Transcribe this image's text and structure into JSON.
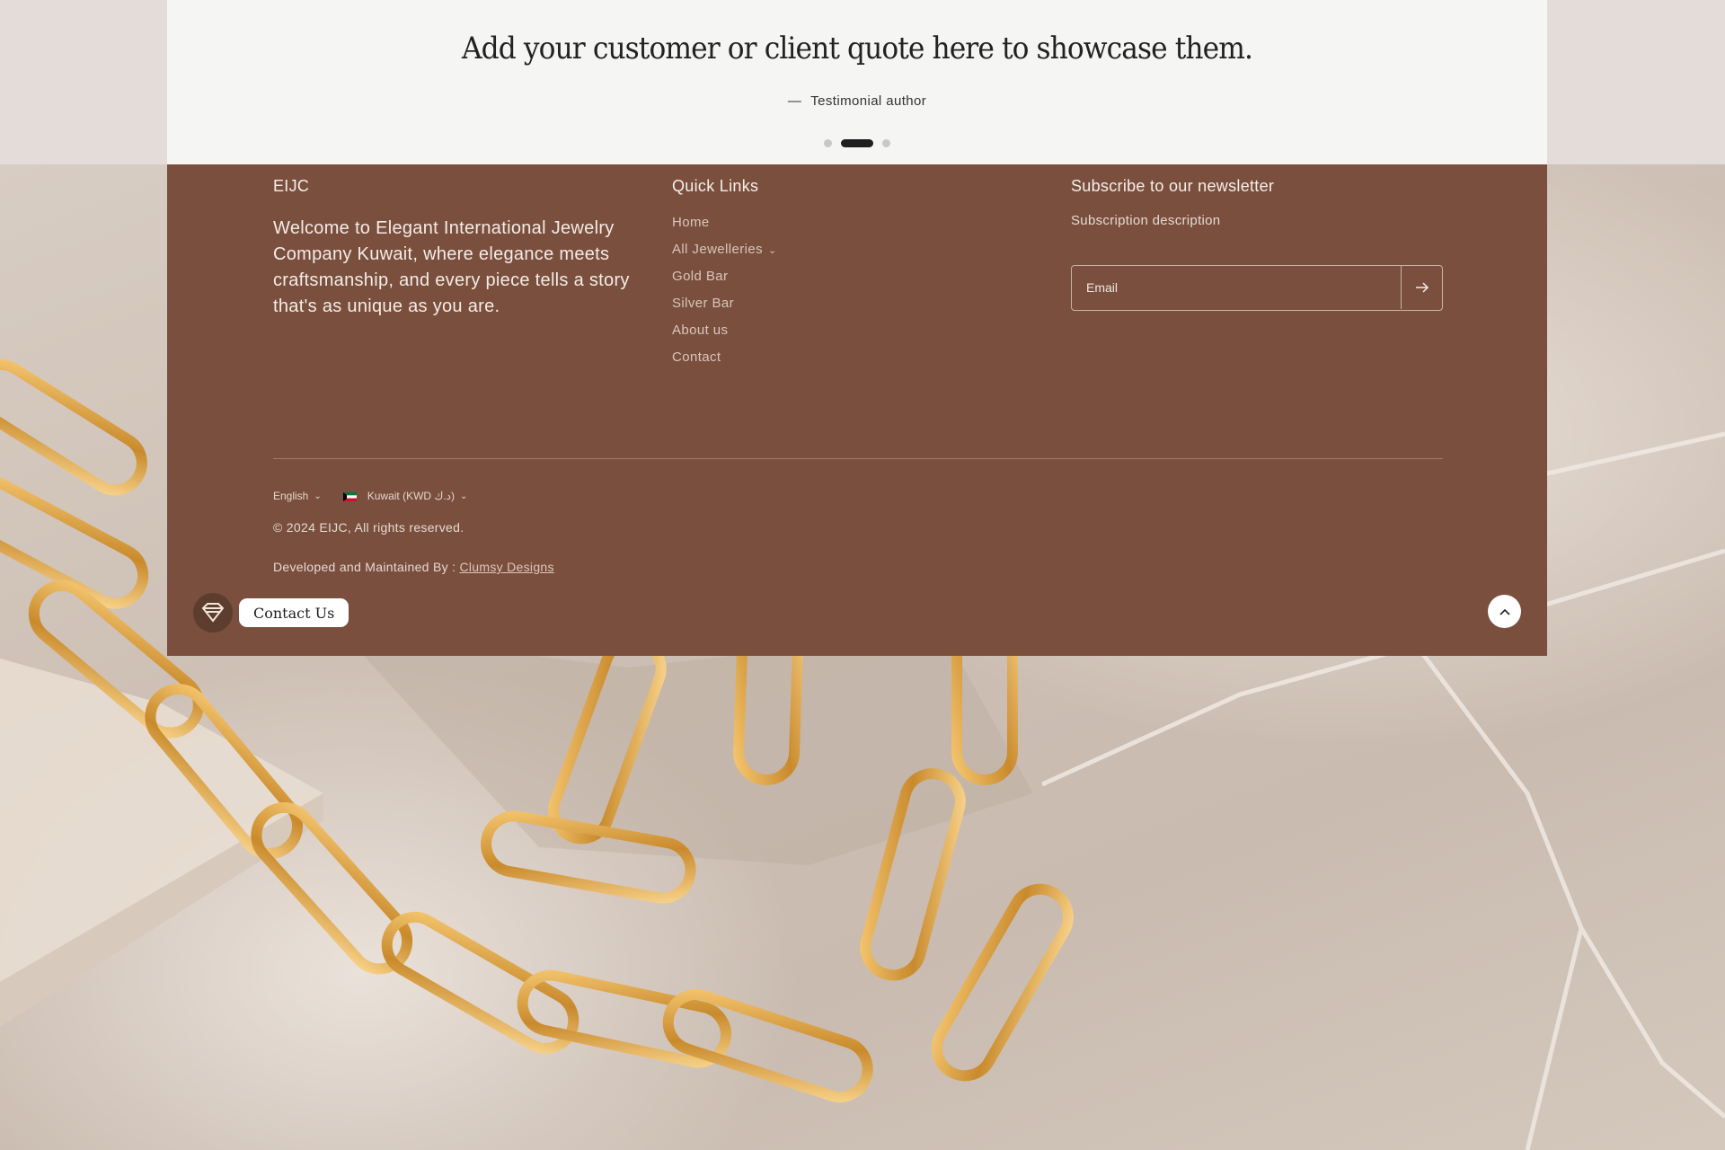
{
  "testimonial": {
    "quote": "Add your customer or client quote here to showcase them.",
    "author_dash": "—",
    "author": "Testimonial author",
    "slides_count": 3,
    "active_slide": 2
  },
  "footer": {
    "brand": {
      "title": "EIJC",
      "text": "Welcome to Elegant International Jewelry Company Kuwait, where elegance meets craftsmanship, and every piece tells a story that's as unique as you are."
    },
    "quick_links": {
      "title": "Quick Links",
      "items": [
        {
          "label": "Home"
        },
        {
          "label": "All Jewelleries",
          "has_dropdown": true
        },
        {
          "label": "Gold Bar"
        },
        {
          "label": "Silver Bar"
        },
        {
          "label": "About us"
        },
        {
          "label": "Contact"
        }
      ]
    },
    "newsletter": {
      "title": "Subscribe to our newsletter",
      "description": "Subscription description",
      "email_placeholder": "Email",
      "submit_icon": "arrow-right-icon"
    },
    "localization": {
      "language": "English",
      "country": "Kuwait (KWD د.ك)"
    },
    "copyright": "© 2024 EIJC, All rights reserved.",
    "developed_prefix": "Developed and Maintained By : ",
    "developed_link": "Clumsy Designs"
  },
  "widgets": {
    "contact_label": "Contact Us",
    "contact_icon": "diamond-logo-icon",
    "scroll_top_icon": "chevron-up-icon"
  },
  "colors": {
    "footer_bg": "#7a4f3e",
    "testimonial_bg": "#f5f5f3",
    "gold": "#d9a24a"
  }
}
